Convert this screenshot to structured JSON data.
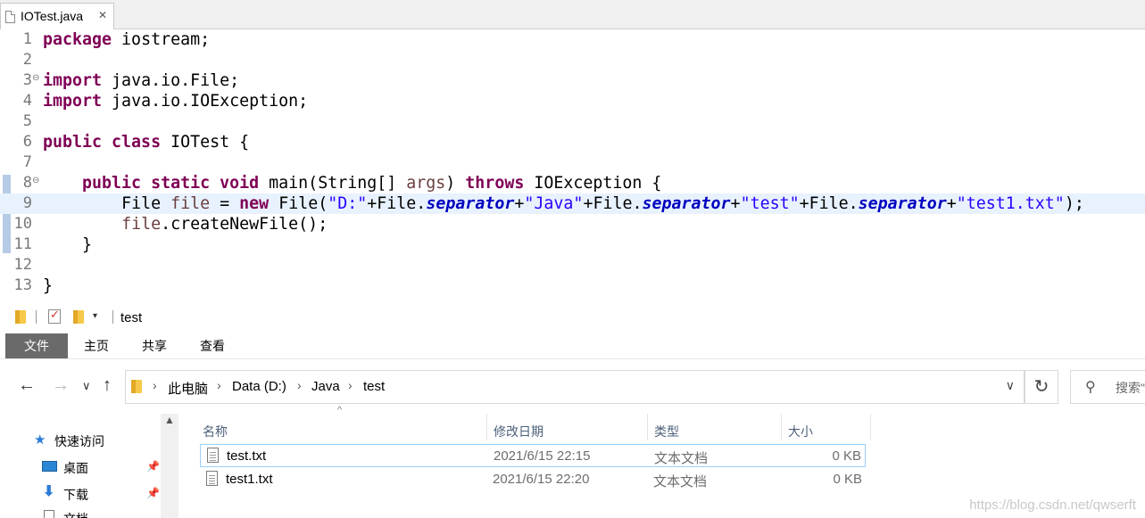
{
  "editor": {
    "tab_title": "IOTest.java",
    "tab_close": "✕",
    "lines": [
      {
        "num": "1"
      },
      {
        "num": "2"
      },
      {
        "num": "3"
      },
      {
        "num": "4"
      },
      {
        "num": "5"
      },
      {
        "num": "6"
      },
      {
        "num": "7"
      },
      {
        "num": "8"
      },
      {
        "num": "9"
      },
      {
        "num": "10"
      },
      {
        "num": "11"
      },
      {
        "num": "12"
      },
      {
        "num": "13"
      }
    ],
    "code": {
      "l1_kw": "package",
      "l1_rest": " iostream;",
      "l3_kw": "import",
      "l3_rest": " java.io.File;",
      "l4_kw": "import",
      "l4_rest": " java.io.IOException;",
      "l6_kw": "public class",
      "l6_rest": " IOTest {",
      "l8_indent": "    ",
      "l8_kw": "public static void",
      "l8_a": " main(String[] ",
      "l8_var": "args",
      "l8_b": ") ",
      "l8_kw2": "throws",
      "l8_c": " IOException {",
      "l9_indent": "        ",
      "l9_a": "File ",
      "l9_var": "file",
      "l9_b": " = ",
      "l9_kw": "new",
      "l9_c": " File(",
      "l9_s1": "\"D:\"",
      "l9_d": "+File.",
      "l9_f1": "separator",
      "l9_e": "+",
      "l9_s2": "\"Java\"",
      "l9_g": "+File.",
      "l9_f2": "separator",
      "l9_h": "+",
      "l9_s3": "\"test\"",
      "l9_i": "+File.",
      "l9_f3": "separator",
      "l9_j": "+",
      "l9_s4": "\"test1.txt\"",
      "l9_k": ");",
      "l10_indent": "        ",
      "l10_var": "file",
      "l10_rest": ".createNewFile();",
      "l11_text": "    }",
      "l13_text": "}"
    },
    "colors": {
      "keyword": "#7f0055",
      "string": "#2a00ff",
      "static_field": "#0000c0",
      "line_highlight": "#e8f2fe"
    }
  },
  "explorer": {
    "window_title": "test",
    "ribbon_tabs": [
      "文件",
      "主页",
      "共享",
      "查看"
    ],
    "address": {
      "crumbs": [
        "此电脑",
        "Data (D:)",
        "Java",
        "test"
      ]
    },
    "search_placeholder": "搜索\"",
    "nav": [
      {
        "label": "快速访问",
        "icon": "star-icon"
      },
      {
        "label": "桌面",
        "icon": "desktop-icon"
      },
      {
        "label": "下载",
        "icon": "download-icon"
      },
      {
        "label": "文档",
        "icon": "document-icon"
      }
    ],
    "columns": [
      "名称",
      "修改日期",
      "类型",
      "大小"
    ],
    "files": [
      {
        "name": "test.txt",
        "modified": "2021/6/15 22:15",
        "type": "文本文档",
        "size": "0 KB"
      },
      {
        "name": "test1.txt",
        "modified": "2021/6/15 22:20",
        "type": "文本文档",
        "size": "0 KB"
      }
    ],
    "watermark": "https://blog.csdn.net/qwserft"
  }
}
